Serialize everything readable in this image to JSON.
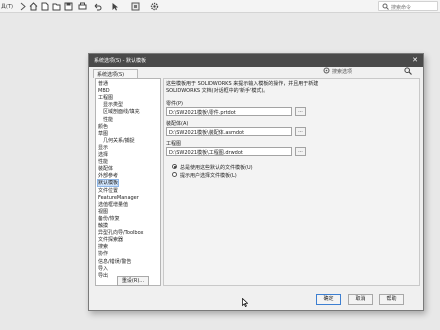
{
  "appbar": {
    "menu_label": "具(T)",
    "search_placeholder": "搜索命令"
  },
  "icons": {
    "toolbar": [
      "chevron-right-icon",
      "home-icon",
      "new-file-icon",
      "open-folder-icon",
      "save-icon",
      "print-icon",
      "undo-icon",
      "select-arrow-icon",
      "rebuild-icon",
      "options-gear-icon"
    ],
    "search": "search-icon"
  },
  "dialog": {
    "title": "系统选项(S) - 默认模板",
    "close_glyph": "✕",
    "tab_label": "系统选项(S)",
    "search_placeholder": "搜索选项",
    "tree_items": [
      {
        "label": "普通",
        "indent": 0
      },
      {
        "label": "MBD",
        "indent": 0
      },
      {
        "label": "工程图",
        "indent": 0
      },
      {
        "label": "显示类型",
        "indent": 1
      },
      {
        "label": "区域剖面线/填充",
        "indent": 1
      },
      {
        "label": "性能",
        "indent": 1
      },
      {
        "label": "颜色",
        "indent": 0
      },
      {
        "label": "草图",
        "indent": 0
      },
      {
        "label": "几何关系/捕捉",
        "indent": 1
      },
      {
        "label": "显示",
        "indent": 0
      },
      {
        "label": "选择",
        "indent": 0
      },
      {
        "label": "性能",
        "indent": 0
      },
      {
        "label": "装配体",
        "indent": 0
      },
      {
        "label": "外部参考",
        "indent": 0
      },
      {
        "label": "默认模板",
        "indent": 0,
        "selected": true
      },
      {
        "label": "文件位置",
        "indent": 0
      },
      {
        "label": "FeatureManager",
        "indent": 0
      },
      {
        "label": "选值框增量值",
        "indent": 0
      },
      {
        "label": "视图",
        "indent": 0
      },
      {
        "label": "备份/恢复",
        "indent": 0
      },
      {
        "label": "触摸",
        "indent": 0
      },
      {
        "label": "异型孔向导/Toolbox",
        "indent": 0
      },
      {
        "label": "文件探索器",
        "indent": 0
      },
      {
        "label": "搜索",
        "indent": 0
      },
      {
        "label": "协作",
        "indent": 0
      },
      {
        "label": "信息/错误/警告",
        "indent": 0
      },
      {
        "label": "导入",
        "indent": 0
      },
      {
        "label": "导出",
        "indent": 0
      }
    ],
    "reset_label": "重设(R)...",
    "description": "这些模板用于 SOLIDWORKS 来提示输入模板的操作，并且用于新建 SOLIDWORKS 文档(对话框中的'新手'模式)。",
    "templates": [
      {
        "label": "零件(P)",
        "path": "D:\\SW2021模板\\零件.prtdot",
        "browse": "..."
      },
      {
        "label": "装配体(A)",
        "path": "D:\\SW2021模板\\装配体.asmdot",
        "browse": "..."
      },
      {
        "label": "工程图",
        "path": "D:\\SW2021模板\\工程图.drwdot",
        "browse": "..."
      }
    ],
    "radio_options": [
      {
        "label": "总是使用这些默认的文件模板(U)",
        "checked": true
      },
      {
        "label": "提示用户选择文件模板(L)",
        "checked": false
      }
    ],
    "buttons": {
      "ok": "确定",
      "cancel": "取消",
      "help": "帮助"
    }
  }
}
